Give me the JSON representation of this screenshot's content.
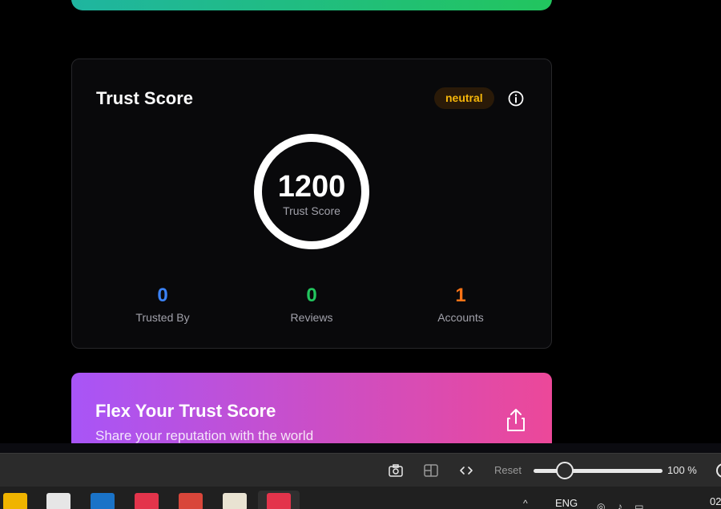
{
  "trust_card": {
    "title": "Trust Score",
    "badge": "neutral",
    "score": "1200",
    "score_label": "Trust Score",
    "stats": [
      {
        "value": "0",
        "label": "Trusted By",
        "color": "#3b82f6"
      },
      {
        "value": "0",
        "label": "Reviews",
        "color": "#22c55e"
      },
      {
        "value": "1",
        "label": "Accounts",
        "color": "#f97316"
      }
    ]
  },
  "flex_card": {
    "title": "Flex Your Trust Score",
    "subtitle": "Share your reputation with the world"
  },
  "devbar": {
    "reset_label": "Reset",
    "zoom_label": "100 %",
    "zoom_level": 0.2
  },
  "taskbar": {
    "language": "ENG",
    "clock_partial": "02"
  },
  "colors": {
    "top_gradient": [
      "#1fb5a0",
      "#22c55e"
    ],
    "flex_gradient": [
      "#a855f7",
      "#ec4899"
    ],
    "badge_text": "#f5b60a"
  }
}
